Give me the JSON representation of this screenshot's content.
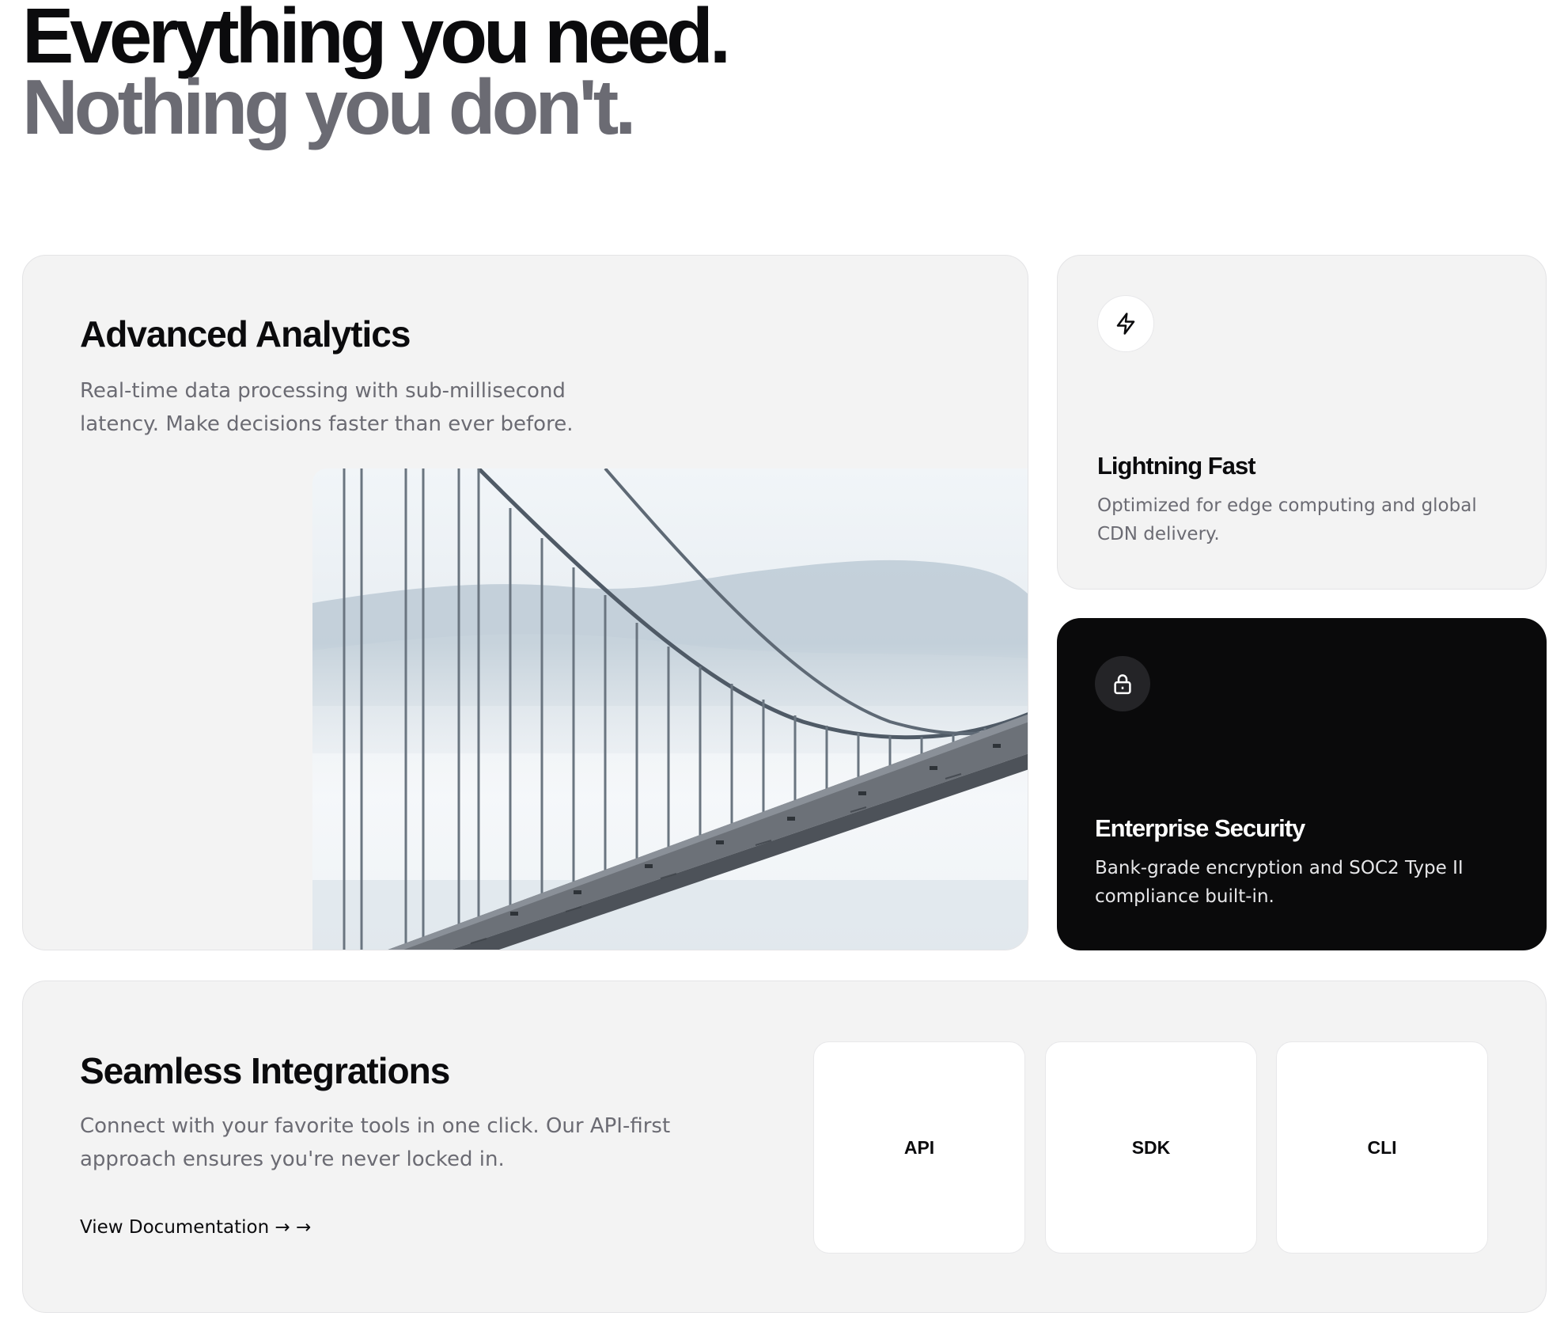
{
  "hero": {
    "line1": "Everything you need.",
    "line2": "Nothing you don't."
  },
  "analytics": {
    "title": "Advanced Analytics",
    "description": "Real-time data processing with sub-millisecond latency. Make decisions faster than ever before."
  },
  "fast": {
    "icon": "lightning-icon",
    "title": "Lightning Fast",
    "description": "Optimized for edge computing and global CDN delivery."
  },
  "security": {
    "icon": "lock-icon",
    "title": "Enterprise Security",
    "description": "Bank-grade encryption and SOC2 Type II compliance built-in."
  },
  "integrations": {
    "title": "Seamless Integrations",
    "description": "Connect with your favorite tools in one click. Our API-first approach ensures you're never locked in.",
    "link_label": "View Documentation → →",
    "tiles": [
      "API",
      "SDK",
      "CLI"
    ]
  },
  "colors": {
    "primary_text": "#0b0b0d",
    "muted_text": "#6b6b73",
    "card_bg": "#f3f3f3",
    "dark_card_bg": "#0a0a0b"
  }
}
